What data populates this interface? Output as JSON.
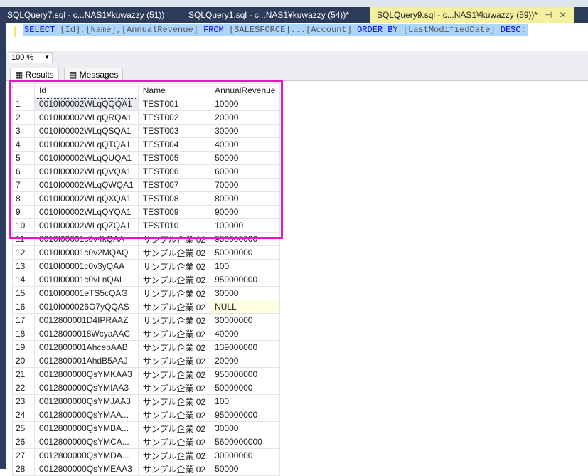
{
  "tabs": [
    {
      "label": "SQLQuery7.sql - c...NAS1¥kuwazzy (51))",
      "active": false
    },
    {
      "label": "SQLQuery1.sql - c...NAS1¥kuwazzy (54))*",
      "active": false
    },
    {
      "label": "SQLQuery9.sql - c...NAS1¥kuwazzy (59))*",
      "active": true
    }
  ],
  "tab_pin": "⊣",
  "tab_close": "✕",
  "editor": {
    "tokens": [
      {
        "t": "SELECT",
        "k": true
      },
      {
        "t": " [Id],[Name],[AnnualRevenue] ",
        "k": false
      },
      {
        "t": "FROM",
        "k": true
      },
      {
        "t": " [SALESFORCE]...[Account] ",
        "k": false
      },
      {
        "t": "ORDER BY",
        "k": true
      },
      {
        "t": " [LastModifiedDate] ",
        "k": false
      },
      {
        "t": "DESC",
        "k": true
      },
      {
        "t": ";",
        "k": false
      }
    ]
  },
  "zoom": "100 %",
  "result_tabs": {
    "results": "Results",
    "messages": "Messages"
  },
  "columns": [
    "Id",
    "Name",
    "AnnualRevenue"
  ],
  "rows": [
    [
      "1",
      "0010I00002WLqQQQA1",
      "TEST001",
      "10000"
    ],
    [
      "2",
      "0010I00002WLqQRQA1",
      "TEST002",
      "20000"
    ],
    [
      "3",
      "0010I00002WLqQSQA1",
      "TEST003",
      "30000"
    ],
    [
      "4",
      "0010I00002WLqQTQA1",
      "TEST004",
      "40000"
    ],
    [
      "5",
      "0010I00002WLqQUQA1",
      "TEST005",
      "50000"
    ],
    [
      "6",
      "0010I00002WLqQVQA1",
      "TEST006",
      "60000"
    ],
    [
      "7",
      "0010I00002WLqQWQA1",
      "TEST007",
      "70000"
    ],
    [
      "8",
      "0010I00002WLqQXQA1",
      "TEST008",
      "80000"
    ],
    [
      "9",
      "0010I00002WLqQYQA1",
      "TEST009",
      "90000"
    ],
    [
      "10",
      "0010I00002WLqQZQA1",
      "TEST010",
      "100000"
    ],
    [
      "11",
      "0010I00001c0v4kQAA",
      "サンプル企業 02",
      "950000000"
    ],
    [
      "12",
      "0010I00001c0v2MQAQ",
      "サンプル企業 02",
      "50000000"
    ],
    [
      "13",
      "0010I00001c0v3yQAA",
      "サンプル企業 02",
      "100"
    ],
    [
      "14",
      "0010I00001c0vLnQAI",
      "サンプル企業 02",
      "950000000"
    ],
    [
      "15",
      "0010I00001eTS5cQAG",
      "サンプル企業 02",
      "30000"
    ],
    [
      "16",
      "0010I000026O7yQQAS",
      "サンプル企業 02",
      "NULL"
    ],
    [
      "17",
      "0012800001D4IPRAAZ",
      "サンプル企業 02",
      "30000000"
    ],
    [
      "18",
      "00128000018WcyaAAC",
      "サンプル企業 02",
      "40000"
    ],
    [
      "19",
      "0012800001AhcebAAB",
      "サンプル企業 02",
      "139000000"
    ],
    [
      "20",
      "0012800001AhdB5AAJ",
      "サンプル企業 02",
      "20000"
    ],
    [
      "21",
      "0012800000QsYMKAA3",
      "サンプル企業 02",
      "950000000"
    ],
    [
      "22",
      "0012800000QsYMIAA3",
      "サンプル企業 02",
      "50000000"
    ],
    [
      "23",
      "0012800000QsYMJAA3",
      "サンプル企業 02",
      "100"
    ],
    [
      "24",
      "0012800000QsYMAA...",
      "サンプル企業 02",
      "950000000"
    ],
    [
      "25",
      "0012800000QsYMBA...",
      "サンプル企業 02",
      "30000"
    ],
    [
      "26",
      "0012800000QsYMCA...",
      "サンプル企業 02",
      "5600000000"
    ],
    [
      "27",
      "0012800000QsYMDA...",
      "サンプル企業 02",
      "30000000"
    ],
    [
      "28",
      "0012800000QsYMEAA3",
      "サンプル企業 02",
      "50000"
    ]
  ],
  "highlight_color": "#e514c5"
}
